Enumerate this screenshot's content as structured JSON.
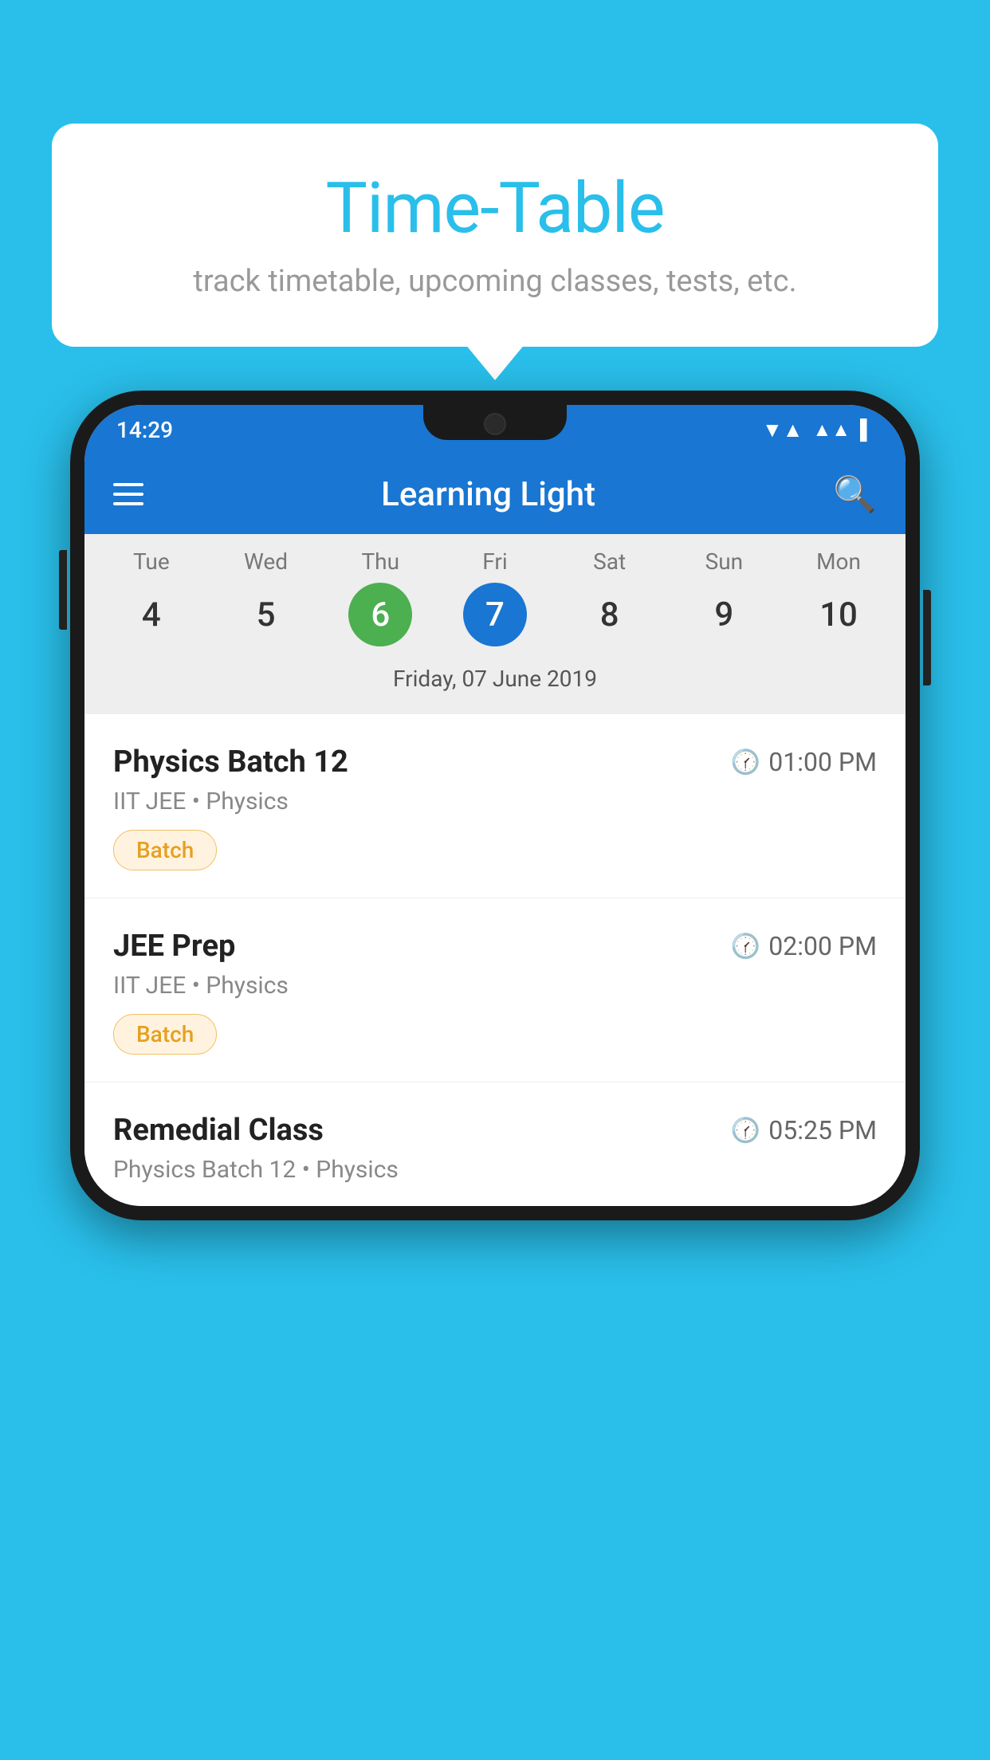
{
  "page": {
    "background_color": "#29BFEA"
  },
  "speech_bubble": {
    "title": "Time-Table",
    "subtitle": "track timetable, upcoming classes, tests, etc."
  },
  "status_bar": {
    "time": "14:29"
  },
  "app_bar": {
    "title": "Learning Light"
  },
  "calendar": {
    "days": [
      {
        "name": "Tue",
        "num": "4",
        "state": "normal"
      },
      {
        "name": "Wed",
        "num": "5",
        "state": "normal"
      },
      {
        "name": "Thu",
        "num": "6",
        "state": "today"
      },
      {
        "name": "Fri",
        "num": "7",
        "state": "selected"
      },
      {
        "name": "Sat",
        "num": "8",
        "state": "normal"
      },
      {
        "name": "Sun",
        "num": "9",
        "state": "normal"
      },
      {
        "name": "Mon",
        "num": "10",
        "state": "normal"
      }
    ],
    "date_label": "Friday, 07 June 2019"
  },
  "schedule": {
    "items": [
      {
        "name": "Physics Batch 12",
        "time": "01:00 PM",
        "sub": "IIT JEE • Physics",
        "badge": "Batch"
      },
      {
        "name": "JEE Prep",
        "time": "02:00 PM",
        "sub": "IIT JEE • Physics",
        "badge": "Batch"
      },
      {
        "name": "Remedial Class",
        "time": "05:25 PM",
        "sub": "Physics Batch 12 • Physics",
        "badge": null
      }
    ]
  }
}
